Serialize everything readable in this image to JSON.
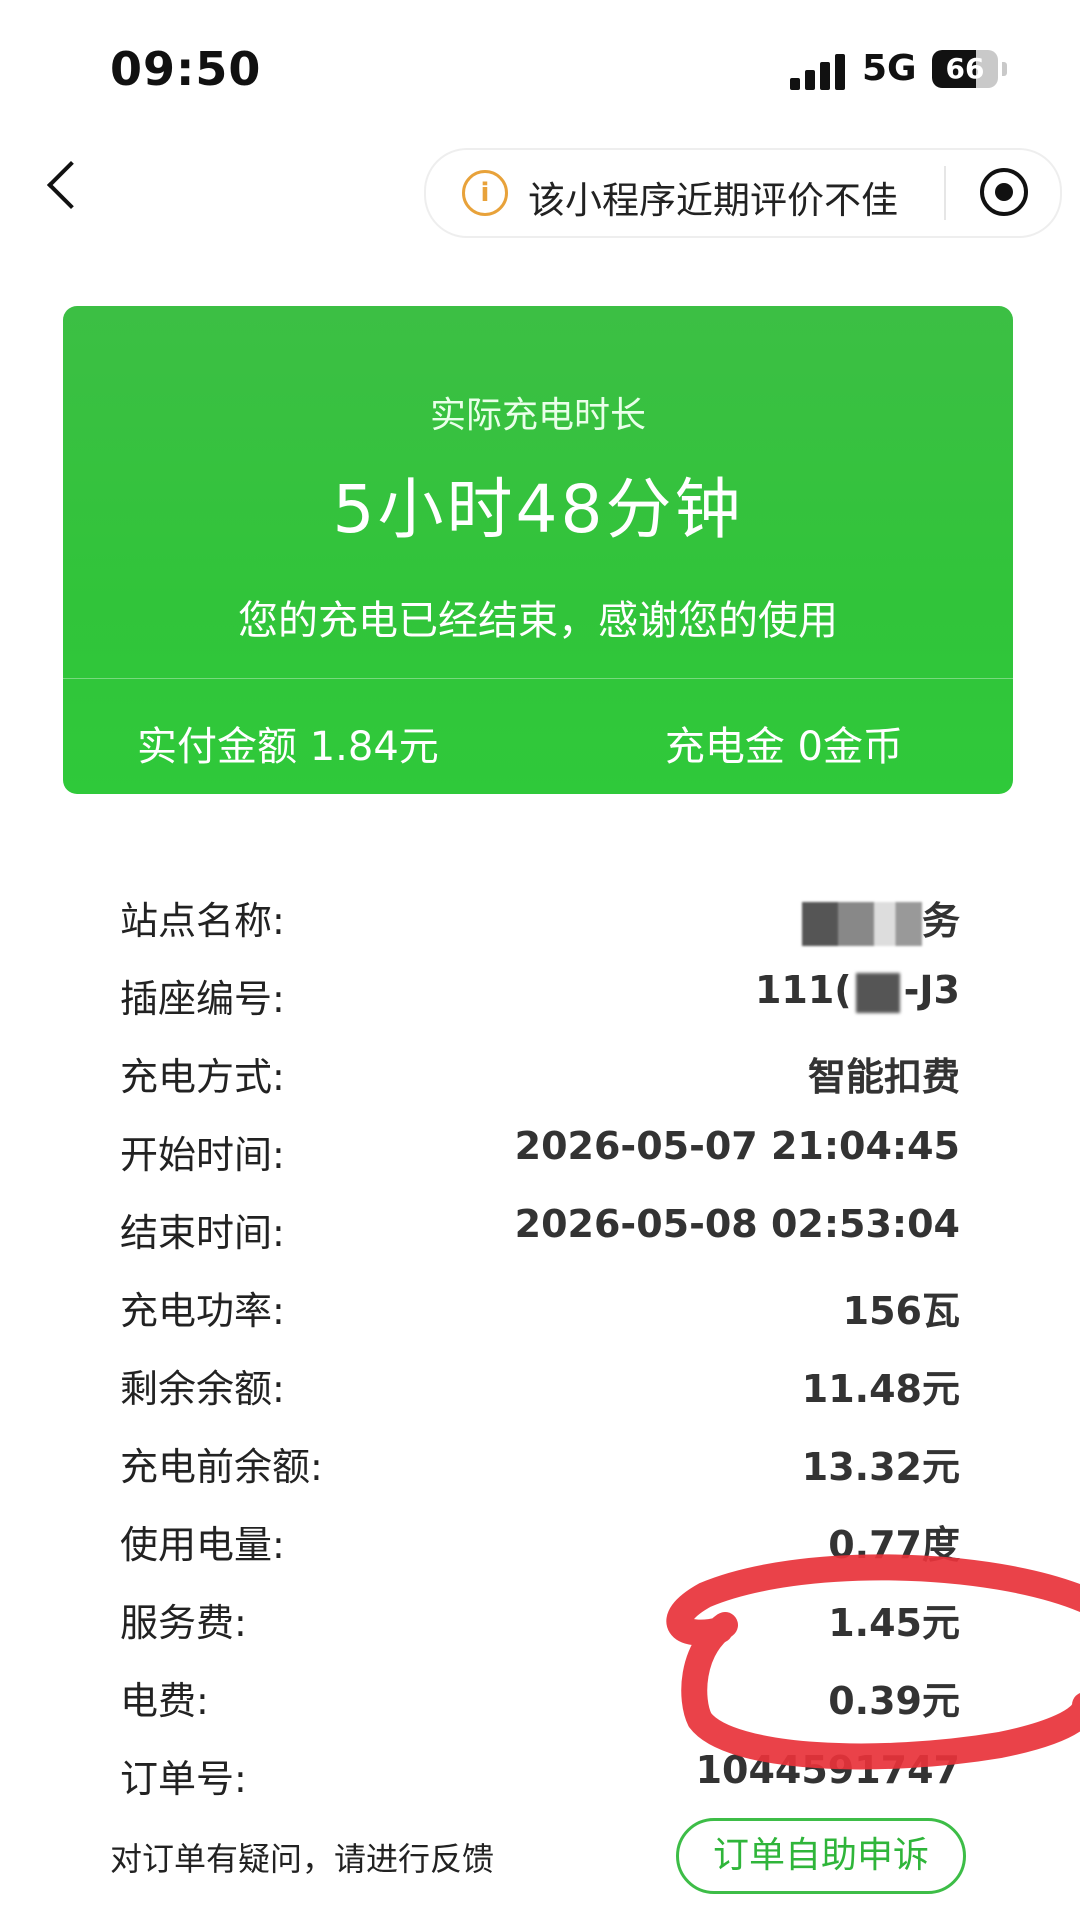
{
  "status_bar": {
    "time": "09:50",
    "network": "5G",
    "battery": "66"
  },
  "nav": {
    "notice_text": "该小程序近期评价不佳"
  },
  "summary": {
    "label": "实际充电时长",
    "duration": "5小时48分钟",
    "message": "您的充电已经结束，感谢您的使用",
    "paid": "实付金额 1.84元",
    "coins": "充电金 0金币"
  },
  "details": [
    {
      "label": "站点名称:",
      "value": ""
    },
    {
      "label": "插座编号:",
      "value": ""
    },
    {
      "label": "充电方式:",
      "value": "智能扣费"
    },
    {
      "label": "开始时间:",
      "value": "2026-05-07 21:04:45"
    },
    {
      "label": "结束时间:",
      "value": "2026-05-08 02:53:04"
    },
    {
      "label": "充电功率:",
      "value": "156瓦"
    },
    {
      "label": "剩余余额:",
      "value": "11.48元"
    },
    {
      "label": "充电前余额:",
      "value": "13.32元"
    },
    {
      "label": "使用电量:",
      "value": "0.77度"
    },
    {
      "label": "服务费:",
      "value": "1.45元"
    },
    {
      "label": "电费:",
      "value": "0.39元"
    },
    {
      "label": "订单号:",
      "value": "1044591747"
    }
  ],
  "socket_partial": {
    "prefix": "111(",
    "suffix": "-J3"
  },
  "station_partial": {
    "suffix": "务"
  },
  "footer": {
    "question": "对订单有疑问，请进行反馈",
    "appeal_button": "订单自助申诉"
  },
  "colors": {
    "accent_green": "#31c43a",
    "annotation_red": "#e8323a",
    "notice_orange": "#e8a23a"
  }
}
